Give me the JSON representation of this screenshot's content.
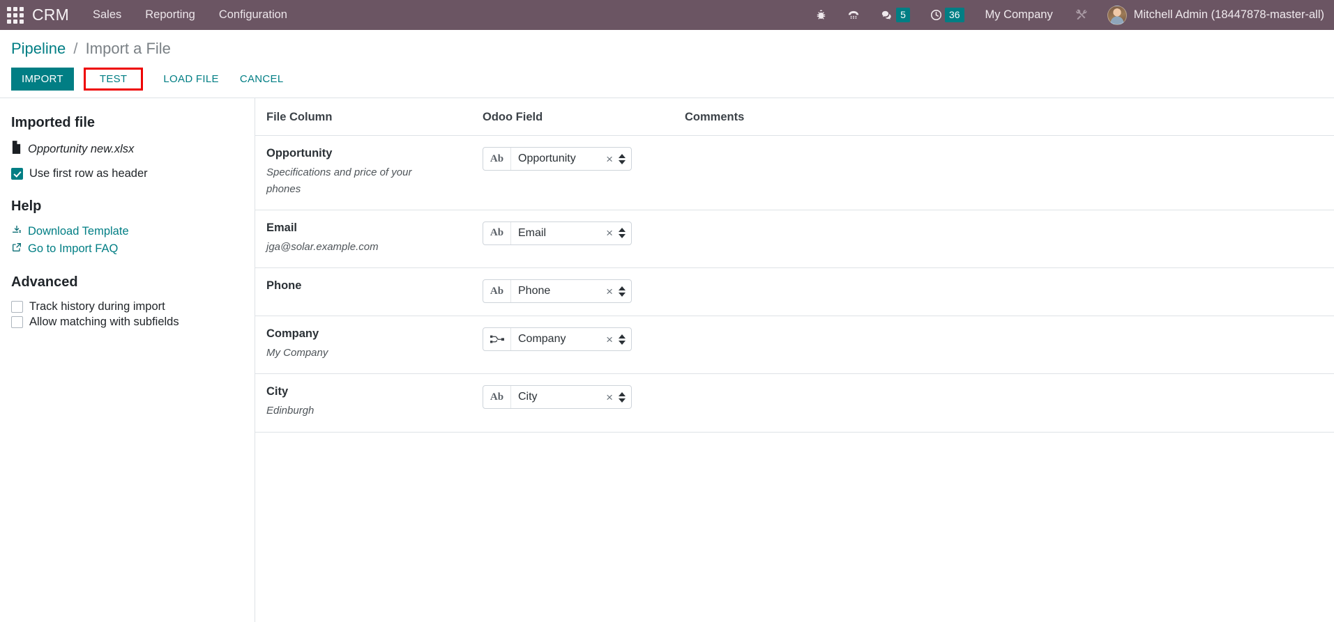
{
  "navbar": {
    "apps_icon": "apps-grid-icon",
    "brand": "CRM",
    "menu": [
      {
        "label": "Sales"
      },
      {
        "label": "Reporting"
      },
      {
        "label": "Configuration"
      }
    ],
    "icons": [
      {
        "name": "bug-icon"
      },
      {
        "name": "phone-dialpad-icon"
      },
      {
        "name": "messages-icon",
        "badge": "5"
      },
      {
        "name": "activities-clock-icon",
        "badge": "36"
      }
    ],
    "company": "My Company",
    "tools_icon": "tools-icon",
    "user": "Mitchell Admin (18447878-master-all)",
    "accent_badge_color": "#017e84",
    "background_color": "#6b5563"
  },
  "control_panel": {
    "breadcrumb": {
      "parent": "Pipeline",
      "separator": "/",
      "current": "Import a File"
    },
    "buttons": [
      {
        "label": "IMPORT",
        "style": "primary"
      },
      {
        "label": "TEST",
        "style": "highlighted"
      },
      {
        "label": "LOAD FILE",
        "style": "link"
      },
      {
        "label": "CANCEL",
        "style": "link"
      }
    ],
    "highlight_color": "#ee0000",
    "primary_color": "#017e84"
  },
  "sidebar": {
    "imported_file_title": "Imported file",
    "file_icon": "file-icon",
    "file_name": "Opportunity new.xlsx",
    "first_row_header": {
      "label": "Use first row as header",
      "checked": true
    },
    "help_title": "Help",
    "help_links": [
      {
        "label": "Download Template",
        "icon": "download-icon"
      },
      {
        "label": "Go to Import FAQ",
        "icon": "external-link-icon"
      }
    ],
    "advanced_title": "Advanced",
    "advanced_options": [
      {
        "label": "Track history during import",
        "checked": false
      },
      {
        "label": "Allow matching with subfields",
        "checked": false
      }
    ]
  },
  "table": {
    "headers": {
      "file_column": "File Column",
      "odoo_field": "Odoo Field",
      "comments": "Comments"
    },
    "rows": [
      {
        "file_column": "Opportunity",
        "sample": "Specifications and price of your phones",
        "field_icon_glyph": "Ab",
        "field_icon_name": "text-field-icon",
        "field_value": "Opportunity",
        "clear_glyph": "×",
        "comments": ""
      },
      {
        "file_column": "Email",
        "sample": "jga@solar.example.com",
        "field_icon_glyph": "Ab",
        "field_icon_name": "text-field-icon",
        "field_value": "Email",
        "clear_glyph": "×",
        "comments": ""
      },
      {
        "file_column": "Phone",
        "sample": "",
        "field_icon_glyph": "Ab",
        "field_icon_name": "text-field-icon",
        "field_value": "Phone",
        "clear_glyph": "×",
        "comments": ""
      },
      {
        "file_column": "Company",
        "sample": "My Company",
        "field_icon_glyph": "relation",
        "field_icon_name": "relation-field-icon",
        "field_value": "Company",
        "clear_glyph": "×",
        "comments": ""
      },
      {
        "file_column": "City",
        "sample": "Edinburgh",
        "field_icon_glyph": "Ab",
        "field_icon_name": "text-field-icon",
        "field_value": "City",
        "clear_glyph": "×",
        "comments": ""
      }
    ]
  }
}
